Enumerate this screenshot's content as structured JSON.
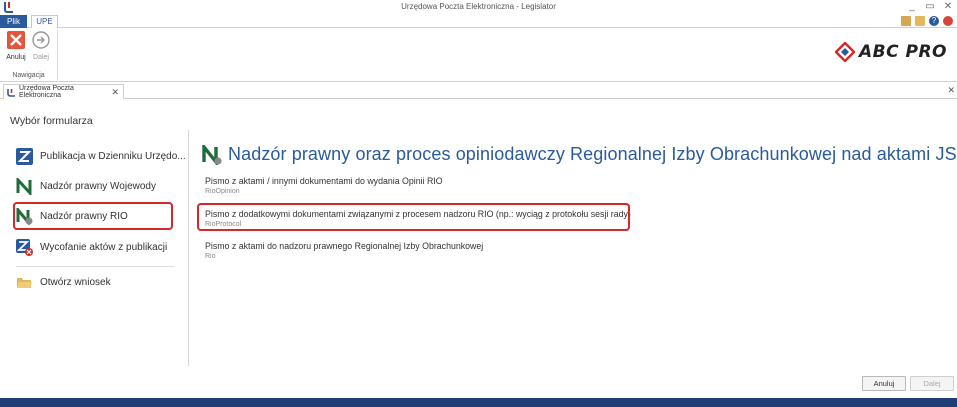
{
  "window": {
    "title": "Urzędowa Poczta Elektroniczna - Legislator",
    "controls": [
      "_",
      "▭",
      "✕"
    ]
  },
  "ribbon": {
    "tabs": [
      "Plik",
      "UPE"
    ],
    "buttons": {
      "cancel": "Anuluj",
      "next": "Dalej"
    },
    "group_label": "Nawigacja",
    "brand": "ABC PRO"
  },
  "doc_tab": {
    "title": "Urzędowa Poczta Elektroniczna",
    "close": "✕",
    "strip_close": "✕"
  },
  "section_title": "Wybór formularza",
  "sidebar": {
    "items": [
      {
        "label": "Publikacja w Dzienniku Urzędo...",
        "icon": "dziennik-z-icon"
      },
      {
        "label": "Nadzór prawny Wojewody",
        "icon": "nadzor-n-icon"
      },
      {
        "label": "Nadzór prawny RIO",
        "icon": "nadzor-rio-icon",
        "selected": true
      },
      {
        "label": "Wycofanie aktów z publikacji",
        "icon": "wycofanie-icon"
      },
      {
        "label": "Otwórz wniosek",
        "icon": "folder-open-icon"
      }
    ]
  },
  "main": {
    "title": "Nadzór prawny oraz proces opiniodawczy Regionalnej Izby Obrachunkowej nad aktami JST",
    "options": [
      {
        "title": "Pismo z aktami / innymi dokumentami do wydania Opinii RIO",
        "code": "RioOpinion"
      },
      {
        "title": "Pismo z dodatkowymi dokumentami związanymi z procesem nadzoru RIO (np.: wyciąg z protokołu sesji rady)",
        "code": "RioProtocol",
        "highlighted": true
      },
      {
        "title": "Pismo z aktami do nadzoru prawnego Regionalnej Izby Obrachunkowej",
        "code": "Rio"
      }
    ]
  },
  "footer": {
    "cancel": "Anuluj",
    "next": "Dalej"
  },
  "colors": {
    "accent_blue": "#2a5a9e",
    "highlight_red": "#d62828",
    "status_bar": "#1e3f73"
  }
}
